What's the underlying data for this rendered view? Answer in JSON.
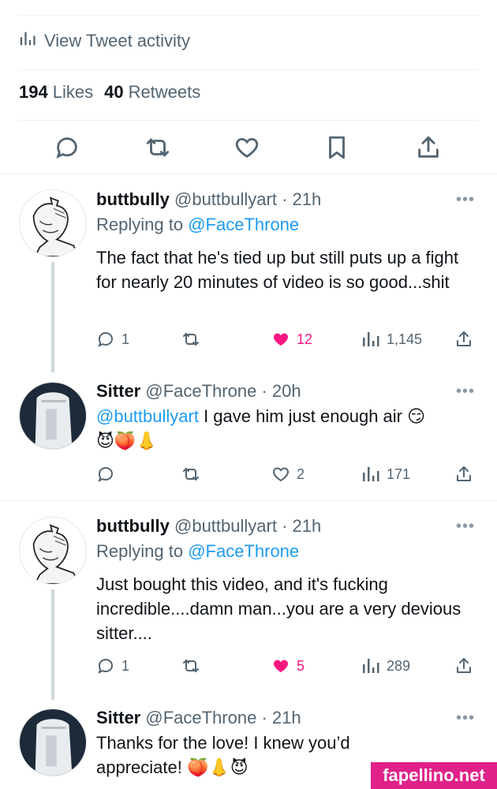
{
  "header": {
    "activity_label": "View Tweet activity",
    "likes_count": "194",
    "likes_label": "Likes",
    "retweets_count": "40",
    "retweets_label": "Retweets"
  },
  "tweets": [
    {
      "name": "buttbully",
      "handle": "@buttbullyart",
      "time": "· 21h",
      "replying_prefix": "Replying to",
      "replying_handle": "@FaceThrone",
      "text": "The fact that he's tied up but still puts up a fight for nearly 20 minutes of video is so good...shit",
      "replies": "1",
      "likes": "12",
      "liked": true,
      "views": "1,145"
    },
    {
      "name": "Sitter",
      "handle": "@FaceThrone",
      "time": "· 20h",
      "mention": "@buttbullyart",
      "text": " I gave him just enough air 😏",
      "emoji_line": "😈🍑👃",
      "likes": "2",
      "liked": false,
      "views": "171"
    },
    {
      "name": "buttbully",
      "handle": "@buttbullyart",
      "time": "· 21h",
      "replying_prefix": "Replying to",
      "replying_handle": "@FaceThrone",
      "text": "Just bought this video, and it's fucking incredible....damn man...you are a very devious sitter....",
      "replies": "1",
      "likes": "5",
      "liked": true,
      "views": "289"
    },
    {
      "name": "Sitter",
      "handle": "@FaceThrone",
      "time": "· 21h",
      "text": "Thanks for the love!  I knew you’d",
      "text_line2": "appreciate! 🍑👃😈"
    }
  ],
  "icons": {
    "more": "•••",
    "accent": "#1d9bf0",
    "like_color": "#f91880"
  },
  "watermark": "fapellino.net"
}
